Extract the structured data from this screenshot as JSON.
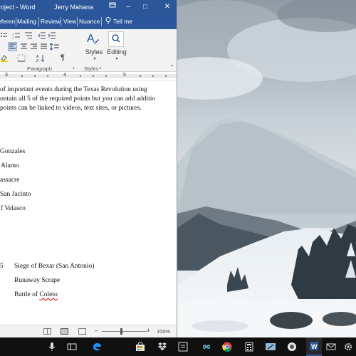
{
  "word": {
    "title_fragment": "roject - Word",
    "user": "Jerry Mahana",
    "window_controls": {
      "minimize": "–",
      "restore": "□",
      "close": "✕"
    },
    "tabs": [
      "eferen",
      "Mailing",
      "Review",
      "View",
      "Nuance"
    ],
    "tell_me": "Tell me",
    "ribbon": {
      "styles_label": "Styles",
      "editing_label": "Editing",
      "group_paragraph": "Paragraph",
      "group_styles": "Styles"
    },
    "ruler_numbers": [
      "3",
      "4",
      "5"
    ],
    "document_lines": [
      "of important events during the Texas Revolution using",
      "ontain all 5 of the required points but you can add additio",
      "points can be linked to videos, text sites, or pictures.",
      "Gonzales",
      "Alamo",
      "assacre",
      "San Jacinto",
      "f Velasco",
      "5",
      "Siege of Bexar (San Antonio)",
      "Runaway Scrape",
      "Battle of Coleto"
    ],
    "spelling_error_word": "Coleto",
    "status": {
      "zoom": "100%",
      "zoom_minus": "–",
      "zoom_plus": "+"
    }
  },
  "taskbar": {
    "icons": [
      "microphone-icon",
      "task-view-icon",
      "edge-icon",
      "store-icon",
      "dropbox-icon",
      "onenote-icon",
      "infinity-icon",
      "chrome-icon",
      "calculator-icon",
      "snipping-icon",
      "word-icon",
      "mail-icon",
      "settings-icon"
    ],
    "colors": {
      "background": "#101010",
      "word_blue": "#2b579a",
      "edge_blue": "#1e90ff"
    }
  },
  "colors": {
    "word_accent": "#2b579a",
    "ribbon_bg": "#f3f3f3",
    "spell_error": "#d00000"
  }
}
